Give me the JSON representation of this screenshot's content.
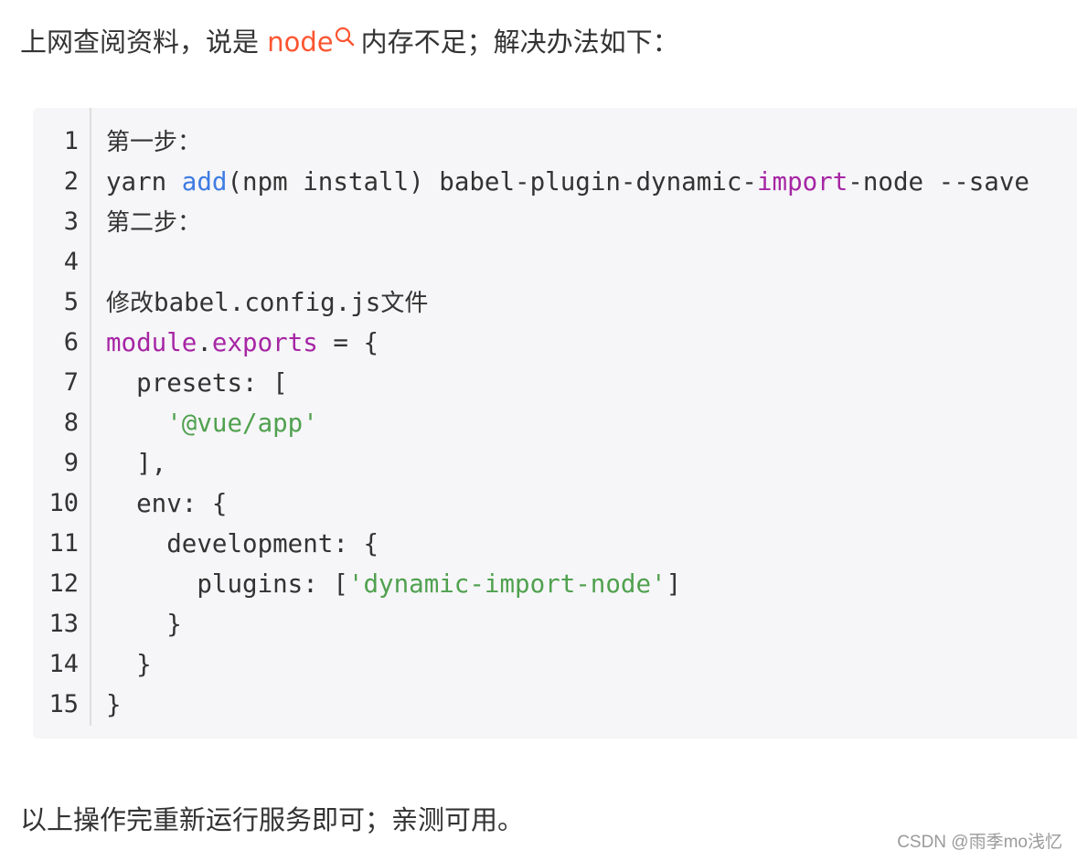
{
  "intro": {
    "before": "上网查阅资料，说是 ",
    "keyword": "node",
    "after": "内存不足；解决办法如下："
  },
  "code": {
    "line_numbers": [
      "1",
      "2",
      "3",
      "4",
      "5",
      "6",
      "7",
      "8",
      "9",
      "10",
      "11",
      "12",
      "13",
      "14",
      "15"
    ],
    "line1": "第一步：",
    "line2": {
      "a": "yarn ",
      "b": "add",
      "c": "(npm install) babel-plugin-dynamic-",
      "d": "import",
      "e": "-node --save"
    },
    "line3": "第二步：",
    "line4": "",
    "line5": {
      "a": "修改",
      "b": "babel.config.js",
      "c": "文件"
    },
    "line6": {
      "a": "module",
      "b": ".",
      "c": "exports",
      "d": " = {"
    },
    "line7": "  presets: [",
    "line8": "    '@vue/app'",
    "line9": "  ],",
    "line10": "  env: {",
    "line11": "    development: {",
    "line12": {
      "a": "      plugins: [",
      "b": "'dynamic-import-node'",
      "c": "]"
    },
    "line13": "    }",
    "line14": "  }",
    "line15": "}"
  },
  "outro": "以上操作完重新运行服务即可；亲测可用。",
  "watermark": "CSDN @雨季mo浅忆",
  "colors": {
    "keyword_link": "#fc5531",
    "code_blue": "#3e7be3",
    "code_purple": "#a626a4",
    "code_green": "#50a14f",
    "code_bg": "#f6f6f8"
  }
}
